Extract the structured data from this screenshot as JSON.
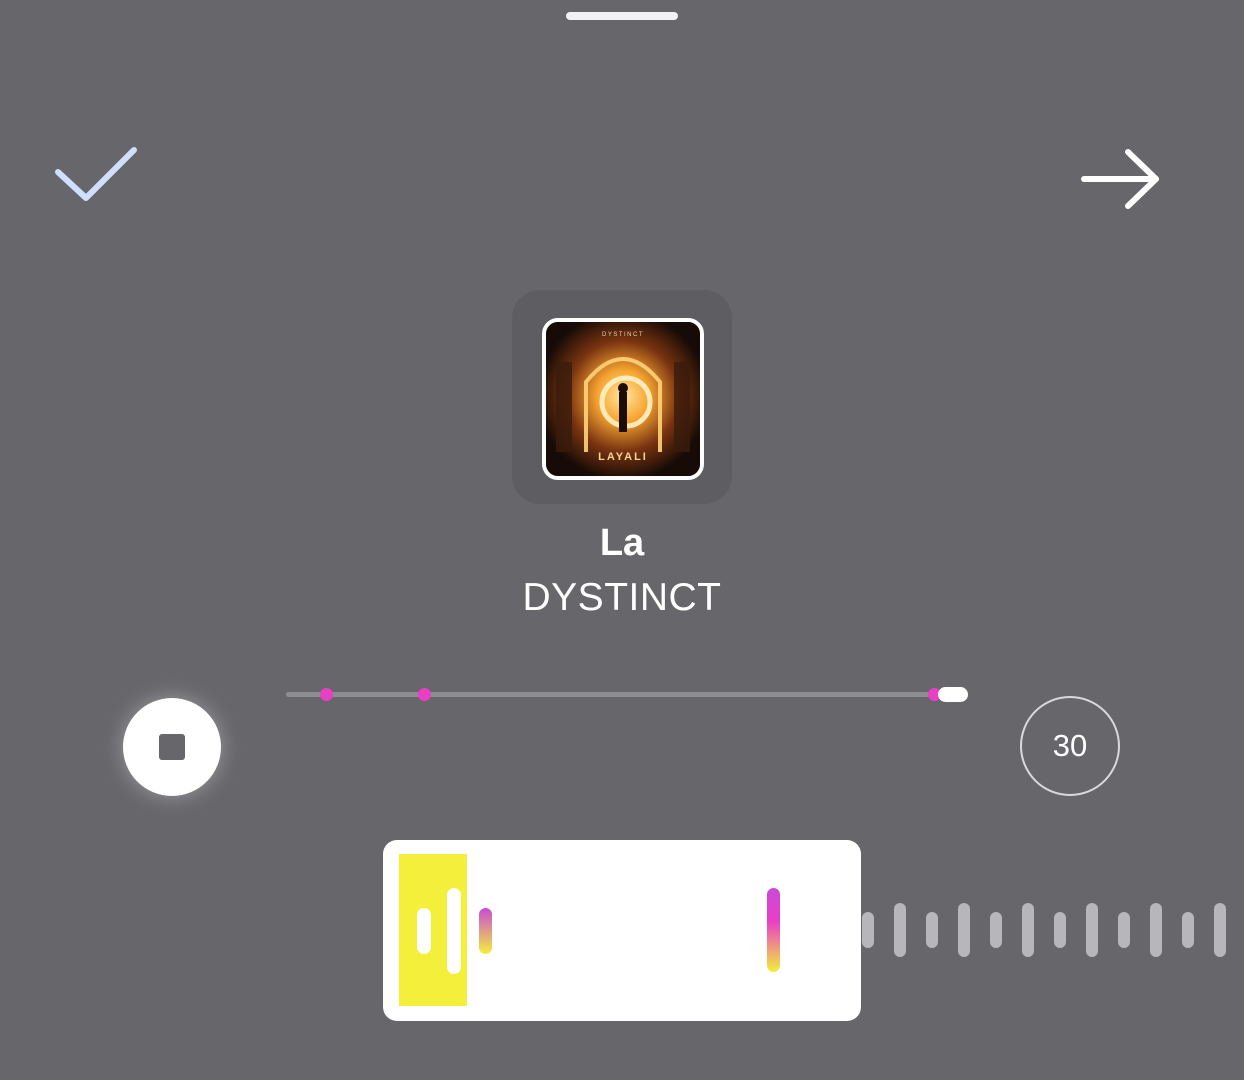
{
  "track": {
    "title": "La",
    "artist": "DYSTINCT",
    "album_cover_text": "LAYALI",
    "album_cover_top_text": "DYSTINCT"
  },
  "icons": {
    "confirm": "checkmark-icon",
    "next": "arrow-right-icon",
    "stop": "stop-icon"
  },
  "playback": {
    "progress_fraction": 0.97
  },
  "duration_button": {
    "label": "30"
  },
  "colors": {
    "background": "#67666b",
    "accent_pink": "#e93fc6",
    "highlight_yellow": "#f4ef3a",
    "check_blue": "#cfe0ff"
  }
}
